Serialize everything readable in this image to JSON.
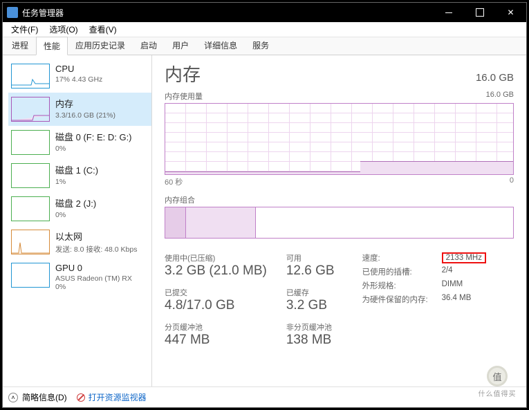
{
  "window": {
    "title": "任务管理器"
  },
  "menu": {
    "file": "文件(F)",
    "options": "选项(O)",
    "view": "查看(V)"
  },
  "tabs": [
    "进程",
    "性能",
    "应用历史记录",
    "启动",
    "用户",
    "详细信息",
    "服务"
  ],
  "sidebar": {
    "items": [
      {
        "name": "CPU",
        "sub": "17% 4.43 GHz"
      },
      {
        "name": "内存",
        "sub": "3.3/16.0 GB (21%)"
      },
      {
        "name": "磁盘 0 (F: E: D: G:)",
        "sub": "0%"
      },
      {
        "name": "磁盘 1 (C:)",
        "sub": "1%"
      },
      {
        "name": "磁盘 2 (J:)",
        "sub": "0%"
      },
      {
        "name": "以太网",
        "sub": "发送: 8.0 接收: 48.0 Kbps"
      },
      {
        "name": "GPU 0",
        "sub": "ASUS Radeon (TM) RX",
        "sub2": "0%"
      }
    ]
  },
  "main": {
    "title": "内存",
    "total": "16.0 GB",
    "usage_label": "内存使用量",
    "usage_max": "16.0 GB",
    "axis_left": "60 秒",
    "axis_right": "0",
    "composition_label": "内存组合",
    "stats": {
      "inuse_label": "使用中(已压缩)",
      "inuse_value": "3.2 GB (21.0 MB)",
      "avail_label": "可用",
      "avail_value": "12.6 GB",
      "commit_label": "已提交",
      "commit_value": "4.8/17.0 GB",
      "cached_label": "已缓存",
      "cached_value": "3.2 GB",
      "paged_label": "分页缓冲池",
      "paged_value": "447 MB",
      "nonpaged_label": "非分页缓冲池",
      "nonpaged_value": "138 MB"
    },
    "right": {
      "speed_label": "速度:",
      "speed_value": "2133 MHz",
      "slots_label": "已使用的插槽:",
      "slots_value": "2/4",
      "form_label": "外形规格:",
      "form_value": "DIMM",
      "reserved_label": "为硬件保留的内存:",
      "reserved_value": "36.4 MB"
    }
  },
  "footer": {
    "brief": "简略信息(D)",
    "resmon": "打开资源监视器"
  },
  "watermark": {
    "symbol": "值",
    "text": "什么值得买"
  },
  "chart_data": {
    "type": "area",
    "title": "内存使用量",
    "ylabel": "GB",
    "ylim": [
      0,
      16
    ],
    "x": [
      60,
      50,
      40,
      34,
      33,
      20,
      10,
      0
    ],
    "values": [
      0.6,
      0.6,
      0.6,
      0.6,
      3.3,
      3.3,
      3.3,
      3.3
    ]
  }
}
